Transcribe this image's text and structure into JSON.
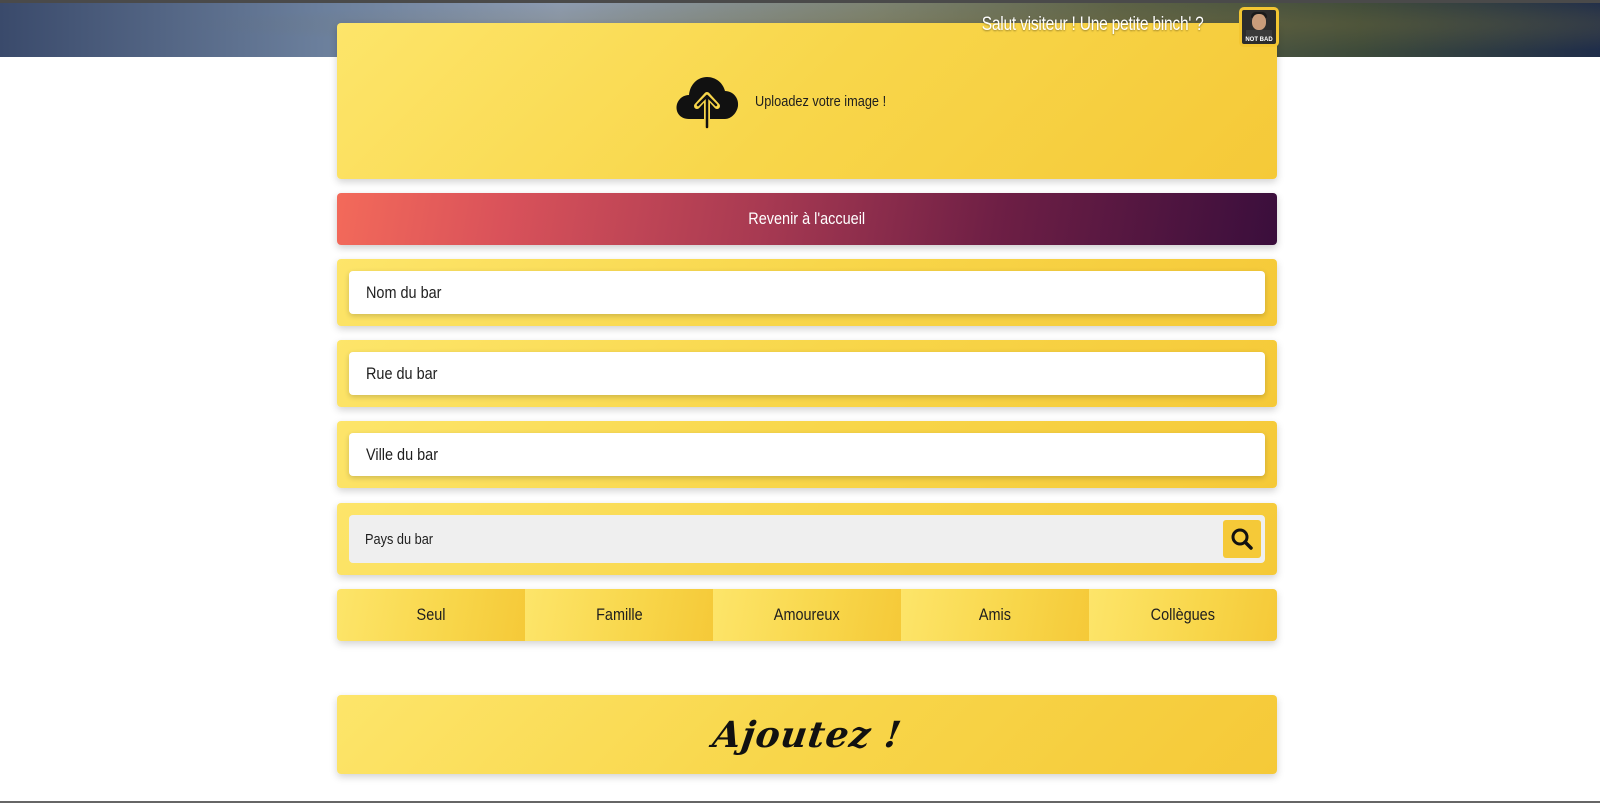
{
  "header": {
    "greeting": "Salut visiteur ! Une petite binch' ?",
    "avatar_caption": "NOT BAD"
  },
  "upload": {
    "label": "Uploadez votre image !",
    "icon": "cloud-upload-icon"
  },
  "back_button": {
    "label": "Revenir à l'accueil"
  },
  "form": {
    "name_placeholder": "Nom du bar",
    "street_placeholder": "Rue du bar",
    "city_placeholder": "Ville du bar",
    "country_placeholder": "Pays du bar",
    "search_icon": "search-icon"
  },
  "categories": [
    {
      "label": "Seul"
    },
    {
      "label": "Famille"
    },
    {
      "label": "Amoureux"
    },
    {
      "label": "Amis"
    },
    {
      "label": "Collègues"
    }
  ],
  "submit": {
    "label": "Ajoutez !"
  },
  "colors": {
    "yellow": "#f8d64a",
    "gradient_start": "#f36a5a",
    "gradient_end": "#3a0e3c"
  }
}
